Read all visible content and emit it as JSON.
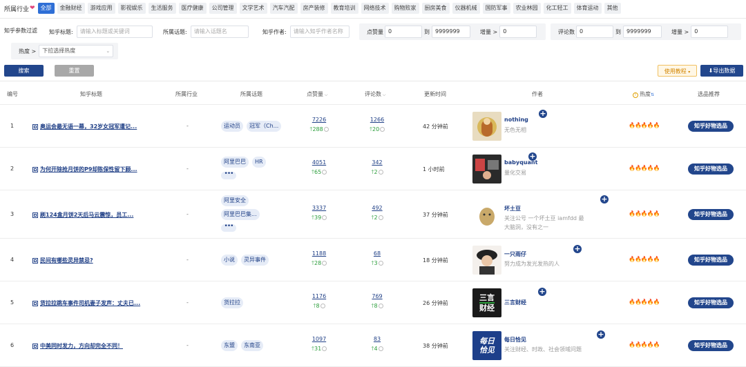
{
  "industry": {
    "label": "所属行业",
    "chips": [
      "全部",
      "金融财经",
      "游戏应用",
      "影视娱乐",
      "生活服务",
      "医疗健康",
      "公司管理",
      "文学艺术",
      "汽车汽配",
      "房产装修",
      "教育培训",
      "网络技术",
      "购物败家",
      "厨房美食",
      "仪器机械",
      "国防军事",
      "农业林园",
      "化工轻工",
      "体育运动",
      "其他"
    ],
    "active_index": 0
  },
  "filters": {
    "section_label": "知乎参数过滤",
    "title_label": "知乎标题:",
    "title_placeholder": "请输入标题或关键词",
    "topic_label": "所属话题:",
    "topic_placeholder": "请输入话题名",
    "author_label": "知乎作者:",
    "author_placeholder": "请输入知乎作者名称",
    "likes_label": "点赞量",
    "likes_min": "0",
    "to": "到",
    "likes_max": "9999999",
    "growth_label": "增量 >",
    "likes_growth": "0",
    "comments_label": "评论数",
    "comments_min": "0",
    "comments_max": "9999999",
    "comments_growth": "0",
    "heat_label": "热度 >",
    "heat_placeholder": "下拉选择热度"
  },
  "actions": {
    "search": "搜索",
    "reset": "重置",
    "tutorial": "使用教程",
    "export": "导出数据"
  },
  "table": {
    "headers": [
      "编号",
      "知乎标题",
      "所属行业",
      "所属话题",
      "点赞量",
      "评论数",
      "更新时间",
      "作者",
      "热度",
      "选品推荐"
    ],
    "recommend_label": "知乎好物选品",
    "heat": "🔥🔥🔥🔥🔥",
    "rows": [
      {
        "id": "1",
        "title": "奥运会最无语一幕，32岁女冠军遭记...",
        "industry": "-",
        "tags": [
          "运动员",
          "冠军（Ch..."
        ],
        "more": false,
        "likes": "7226",
        "likes_inc": "288",
        "comments": "1266",
        "comments_inc": "20",
        "updated": "42 分钟前",
        "author": "nothing",
        "desc": "无色无相"
      },
      {
        "id": "2",
        "title": "为何开除抢月饼的P9却陈保性留下顾...",
        "industry": "-",
        "tags": [
          "阿里巴巴",
          "HR"
        ],
        "more": true,
        "likes": "4051",
        "likes_inc": "65",
        "comments": "342",
        "comments_inc": "2",
        "updated": "1 小时前",
        "author": "babyquant",
        "desc": "量化交易"
      },
      {
        "id": "3",
        "title": "刷124盒月饼2天后马云震惊，员工...",
        "industry": "-",
        "tags": [
          "阿里安全",
          "阿里巴巴集..."
        ],
        "more": true,
        "likes": "3337",
        "likes_inc": "39",
        "comments": "492",
        "comments_inc": "2",
        "updated": "37 分钟前",
        "author": "坏土豆",
        "desc": "关注公号 一个坏土豆 iamfdd 最大脑洞，没有之一"
      },
      {
        "id": "4",
        "title": "民间有哪些灵异禁忌?",
        "industry": "-",
        "tags": [
          "小说",
          "灵异事件"
        ],
        "more": false,
        "likes": "1188",
        "likes_inc": "28",
        "comments": "68",
        "comments_inc": "3",
        "updated": "18 分钟前",
        "author": "一只雨仔",
        "desc": "努力成为发光发热的人"
      },
      {
        "id": "5",
        "title": "货拉拉跳车事件司机妻子发声：丈夫已...",
        "industry": "-",
        "tags": [
          "货拉拉"
        ],
        "more": false,
        "likes": "1176",
        "likes_inc": "8",
        "comments": "769",
        "comments_inc": "8",
        "updated": "26 分钟前",
        "author": "三言财经",
        "desc": ""
      },
      {
        "id": "6",
        "title": "中美同时发力，方向却完全不同！",
        "industry": "-",
        "tags": [
          "东盟",
          "东南亚"
        ],
        "more": false,
        "likes": "1097",
        "likes_inc": "31",
        "comments": "83",
        "comments_inc": "4",
        "updated": "38 分钟前",
        "author": "每日恰见",
        "desc": "关注财经、时政、社会领域问题"
      }
    ],
    "avatar_text": {
      "5_a": "三言",
      "5_b": "财经",
      "6_a": "每日",
      "6_b": "恰见"
    }
  }
}
